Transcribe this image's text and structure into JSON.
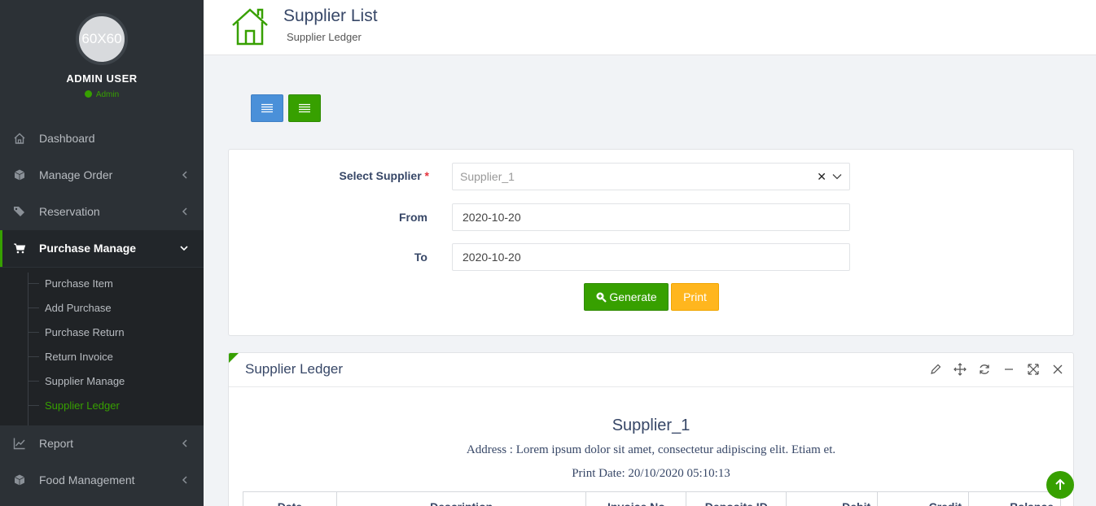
{
  "sidebar": {
    "avatar_text": "60X60",
    "username": "ADMIN USER",
    "role": "Admin",
    "items": [
      {
        "label": "Dashboard",
        "icon": "home-icon"
      },
      {
        "label": "Manage Order",
        "icon": "cube-icon"
      },
      {
        "label": "Reservation",
        "icon": "tags-icon"
      },
      {
        "label": "Purchase Manage",
        "icon": "cart-icon"
      },
      {
        "label": "Report",
        "icon": "chart-icon"
      },
      {
        "label": "Food Management",
        "icon": "cube-icon"
      }
    ],
    "submenu": [
      "Purchase Item",
      "Add Purchase",
      "Purchase Return",
      "Return Invoice",
      "Supplier Manage",
      "Supplier Ledger"
    ],
    "active_color": "#37a000"
  },
  "header": {
    "title": "Supplier List",
    "subtitle": "Supplier Ledger"
  },
  "filter": {
    "supplier_label": "Select Supplier",
    "required_mark": "*",
    "supplier_value": "Supplier_1",
    "from_label": "From",
    "from_value": "2020-10-20",
    "to_label": "To",
    "to_value": "2020-10-20",
    "generate_label": "Generate",
    "print_label": "Print"
  },
  "ledger": {
    "panel_title": "Supplier Ledger",
    "supplier_name": "Supplier_1",
    "address": "Address : Lorem ipsum dolor sit amet, consectetur adipiscing elit. Etiam et.",
    "print_date": "Print Date: 20/10/2020 05:10:13",
    "columns": [
      "Date",
      "Description",
      "Invoice No",
      "Deposite ID",
      "Debit",
      "Credit",
      "Balance"
    ]
  },
  "colors": {
    "primary_green": "#37a000",
    "blue": "#4a90d9",
    "warning": "#ffb61e"
  }
}
